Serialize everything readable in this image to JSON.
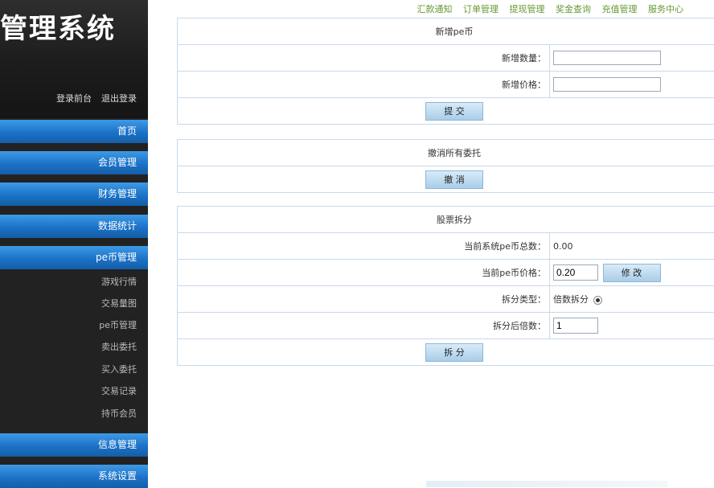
{
  "sidebar": {
    "system_title": "管理系统",
    "login_links": [
      "登录前台",
      "退出登录"
    ],
    "menu": {
      "home": "首页",
      "member": "会员管理",
      "finance": "财务管理",
      "stats": "数据统计",
      "pe": "pe币管理",
      "info": "信息管理",
      "settings": "系统设置"
    },
    "pe_sub": [
      "游戏行情",
      "交易量图",
      "pe币管理",
      "卖出委托",
      "买入委托",
      "交易记录",
      "持币会员"
    ]
  },
  "topnav": [
    "汇款通知",
    "订单管理",
    "提现管理",
    "奖金查询",
    "充值管理",
    "服务中心"
  ],
  "add_pe": {
    "title": "新增pe币",
    "qty_label": "新增数量：",
    "qty_value": "",
    "price_label": "新增价格：",
    "price_value": "",
    "submit": "提 交"
  },
  "cancel_all": {
    "title": "撤消所有委托",
    "button": "撤 消"
  },
  "split": {
    "title": "股票拆分",
    "total_label": "当前系统pe币总数：",
    "total_value": "0.00",
    "price_label": "当前pe币价格：",
    "price_value": "0.20",
    "modify_button": "修 改",
    "type_label": "拆分类型：",
    "type_option": "倍数拆分",
    "multiple_label": "拆分后倍数：",
    "multiple_value": "1",
    "split_button": "拆 分"
  }
}
